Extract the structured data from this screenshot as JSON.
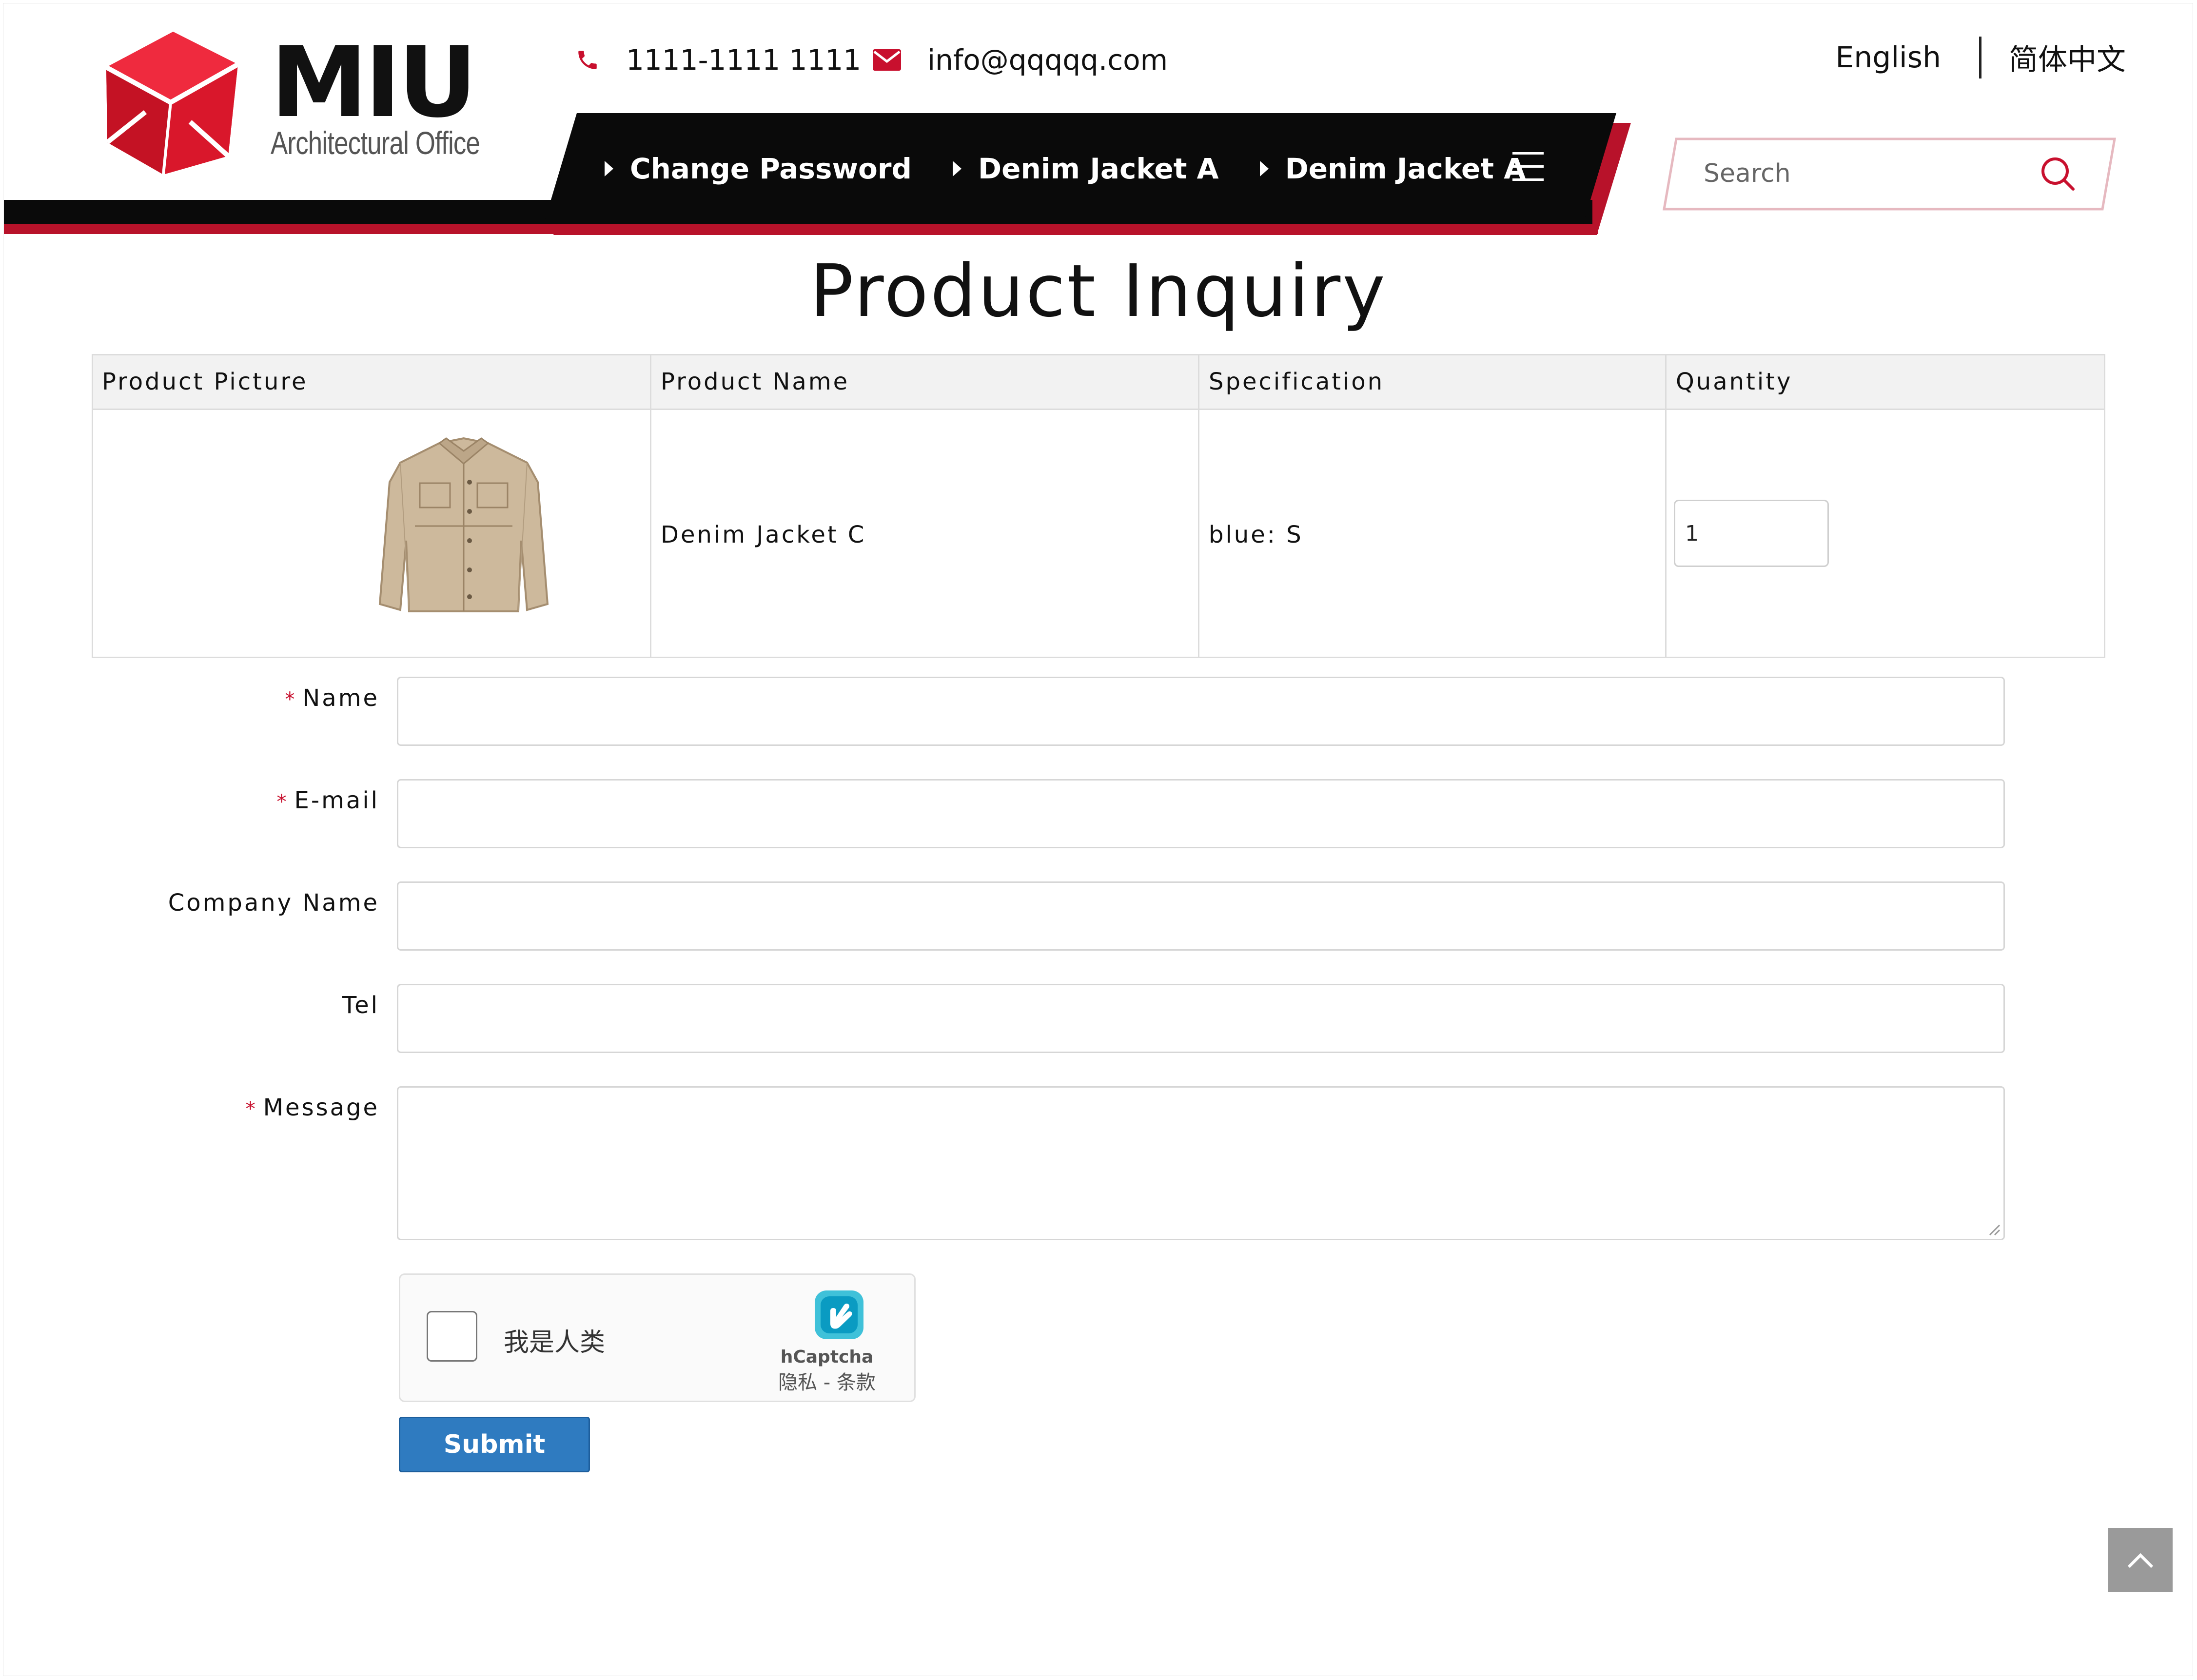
{
  "brand": {
    "name": "MIU",
    "tagline": "Architectural Office"
  },
  "header": {
    "phone": "1111-1111 1111",
    "email": "info@qqqqq.com",
    "lang_en": "English",
    "lang_zh": "简体中文"
  },
  "nav": {
    "items": [
      {
        "label": "Change Password"
      },
      {
        "label": "Denim Jacket A"
      },
      {
        "label": "Denim Jacket A"
      }
    ]
  },
  "search": {
    "placeholder": "Search"
  },
  "page": {
    "title": "Product Inquiry"
  },
  "table": {
    "headers": [
      "Product Picture",
      "Product Name",
      "Specification",
      "Quantity"
    ],
    "rows": [
      {
        "name": "Denim Jacket C",
        "specification": "blue: S",
        "quantity": "1"
      }
    ]
  },
  "form": {
    "name_label": "Name",
    "email_label": "E-mail",
    "company_label": "Company Name",
    "tel_label": "Tel",
    "message_label": "Message",
    "required_mark": "*",
    "submit_label": "Submit"
  },
  "captcha": {
    "checkbox_label": "我是人类",
    "brand": "hCaptcha",
    "links": "隐私 - 条款"
  },
  "colors": {
    "accent_red": "#b8122a",
    "nav_black": "#0a0a0a",
    "submit_blue": "#2f7bc0",
    "back_to_top": "#9a9a9a"
  },
  "icons": [
    "phone-icon",
    "mail-icon",
    "search-icon",
    "menu-icon",
    "chevron-up-icon",
    "hcaptcha-logo-icon",
    "logo-cube-icon"
  ]
}
